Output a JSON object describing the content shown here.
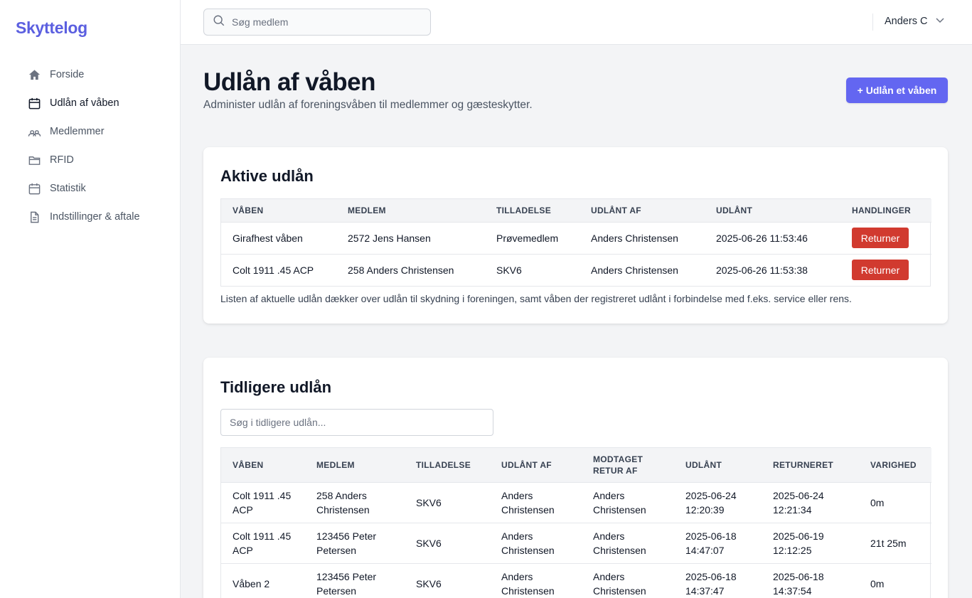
{
  "app": {
    "name": "Skyttelog"
  },
  "sidebar": {
    "items": [
      {
        "label": "Forside",
        "icon": "home-icon"
      },
      {
        "label": "Udlån af våben",
        "icon": "calendar-icon"
      },
      {
        "label": "Medlemmer",
        "icon": "members-icon"
      },
      {
        "label": "RFID",
        "icon": "folder-icon"
      },
      {
        "label": "Statistik",
        "icon": "calendar-icon"
      },
      {
        "label": "Indstillinger & aftale",
        "icon": "document-icon"
      }
    ]
  },
  "topbar": {
    "search_placeholder": "Søg medlem",
    "user_name": "Anders C"
  },
  "page": {
    "title": "Udlån af våben",
    "subtitle": "Administer udlån af foreningsvåben til medlemmer og gæsteskytter.",
    "primary_button": "+ Udlån et våben"
  },
  "active_loans": {
    "title": "Aktive udlån",
    "headers": [
      "VÅBEN",
      "MEDLEM",
      "TILLADELSE",
      "UDLÅNT AF",
      "UDLÅNT",
      "HANDLINGER"
    ],
    "rows": [
      {
        "weapon": "Girafhest våben",
        "member": "2572 Jens Hansen",
        "permit": "Prøvemedlem",
        "lent_by": "Anders Christensen",
        "lent": "2025-06-26 11:53:46",
        "action": "Returner"
      },
      {
        "weapon": "Colt 1911 .45 ACP",
        "member": "258 Anders Christensen",
        "permit": "SKV6",
        "lent_by": "Anders Christensen",
        "lent": "2025-06-26 11:53:38",
        "action": "Returner"
      }
    ],
    "note": "Listen af aktuelle udlån dækker over udlån til skydning i foreningen, samt våben der registreret udlånt i forbindelse med f.eks. service eller rens."
  },
  "previous_loans": {
    "title": "Tidligere udlån",
    "search_placeholder": "Søg i tidligere udlån...",
    "headers": [
      "VÅBEN",
      "MEDLEM",
      "TILLADELSE",
      "UDLÅNT AF",
      "MODTAGET RETUR AF",
      "UDLÅNT",
      "RETURNERET",
      "VARIGHED"
    ],
    "rows": [
      {
        "weapon": "Colt 1911 .45 ACP",
        "member": "258 Anders Christensen",
        "permit": "SKV6",
        "lent_by": "Anders Christensen",
        "received_by": "Anders Christensen",
        "lent": "2025-06-24 12:20:39",
        "returned": "2025-06-24 12:21:34",
        "duration": "0m"
      },
      {
        "weapon": "Colt 1911 .45 ACP",
        "member": "123456 Peter Petersen",
        "permit": "SKV6",
        "lent_by": "Anders Christensen",
        "received_by": "Anders Christensen",
        "lent": "2025-06-18 14:47:07",
        "returned": "2025-06-19 12:12:25",
        "duration": "21t 25m"
      },
      {
        "weapon": "Våben 2",
        "member": "123456 Peter Petersen",
        "permit": "SKV6",
        "lent_by": "Anders Christensen",
        "received_by": "Anders Christensen",
        "lent": "2025-06-18 14:37:47",
        "returned": "2025-06-18 14:37:54",
        "duration": "0m"
      }
    ]
  },
  "colors": {
    "accent": "#6366f1",
    "logo": "#5b5fe0",
    "danger": "#d13a2f"
  }
}
